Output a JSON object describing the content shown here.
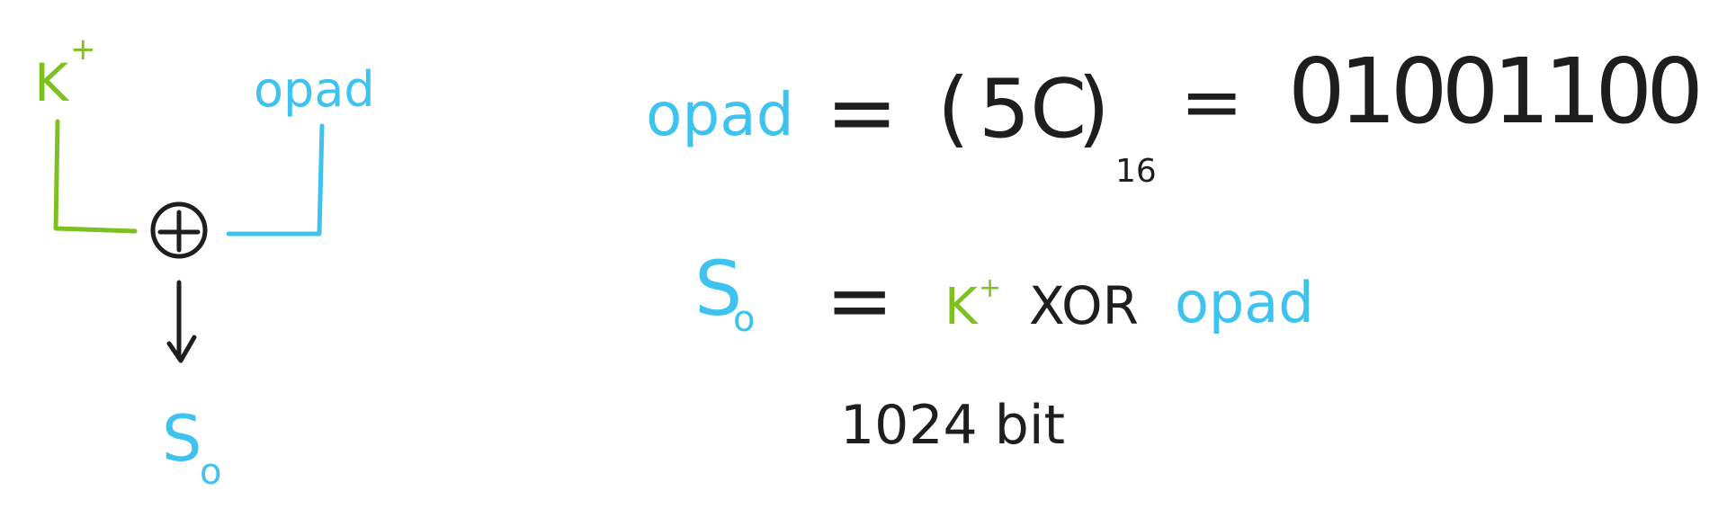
{
  "colors": {
    "green": "#7cc11f",
    "blue": "#3ec3f0",
    "ink": "#1e1e1e"
  },
  "diagram": {
    "k_plus": {
      "base": "K",
      "sup": "+"
    },
    "opad": "opad",
    "xor_symbol": "xor-circle",
    "output": {
      "base": "S",
      "sub": "o"
    }
  },
  "equation1": {
    "lhs": "opad",
    "equals": "=",
    "hex_open": "(",
    "hex_value": "5C",
    "hex_close": ")",
    "hex_base": "16",
    "equals2": "=",
    "binary": "01001100"
  },
  "equation2": {
    "lhs_base": "S",
    "lhs_sub": "o",
    "equals": "=",
    "k_base": "K",
    "k_sup": "+",
    "op": "XOR",
    "rhs": "opad"
  },
  "size_note": "1024 bit"
}
